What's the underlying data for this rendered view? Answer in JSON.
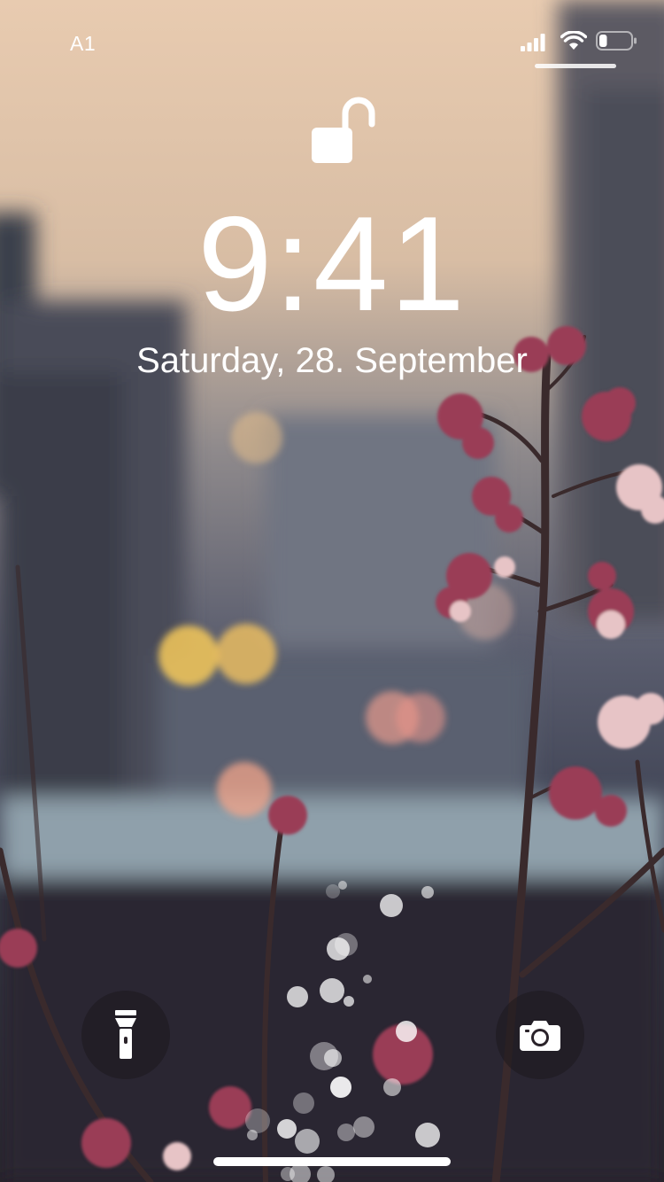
{
  "status_bar": {
    "carrier": "A1",
    "signal_icon": "cellular-signal-icon",
    "wifi_icon": "wifi-icon",
    "battery_icon": "battery-icon",
    "battery_level": 0.25
  },
  "lock": {
    "icon": "unlocked-padlock-icon",
    "time": "9:41",
    "date": "Saturday, 28. September"
  },
  "quick_actions": {
    "flashlight_icon": "flashlight-icon",
    "camera_icon": "camera-icon"
  },
  "colors": {
    "sky": "#e6c9ab",
    "shadow": "#2a2c38",
    "blossom": "#b8607a"
  }
}
